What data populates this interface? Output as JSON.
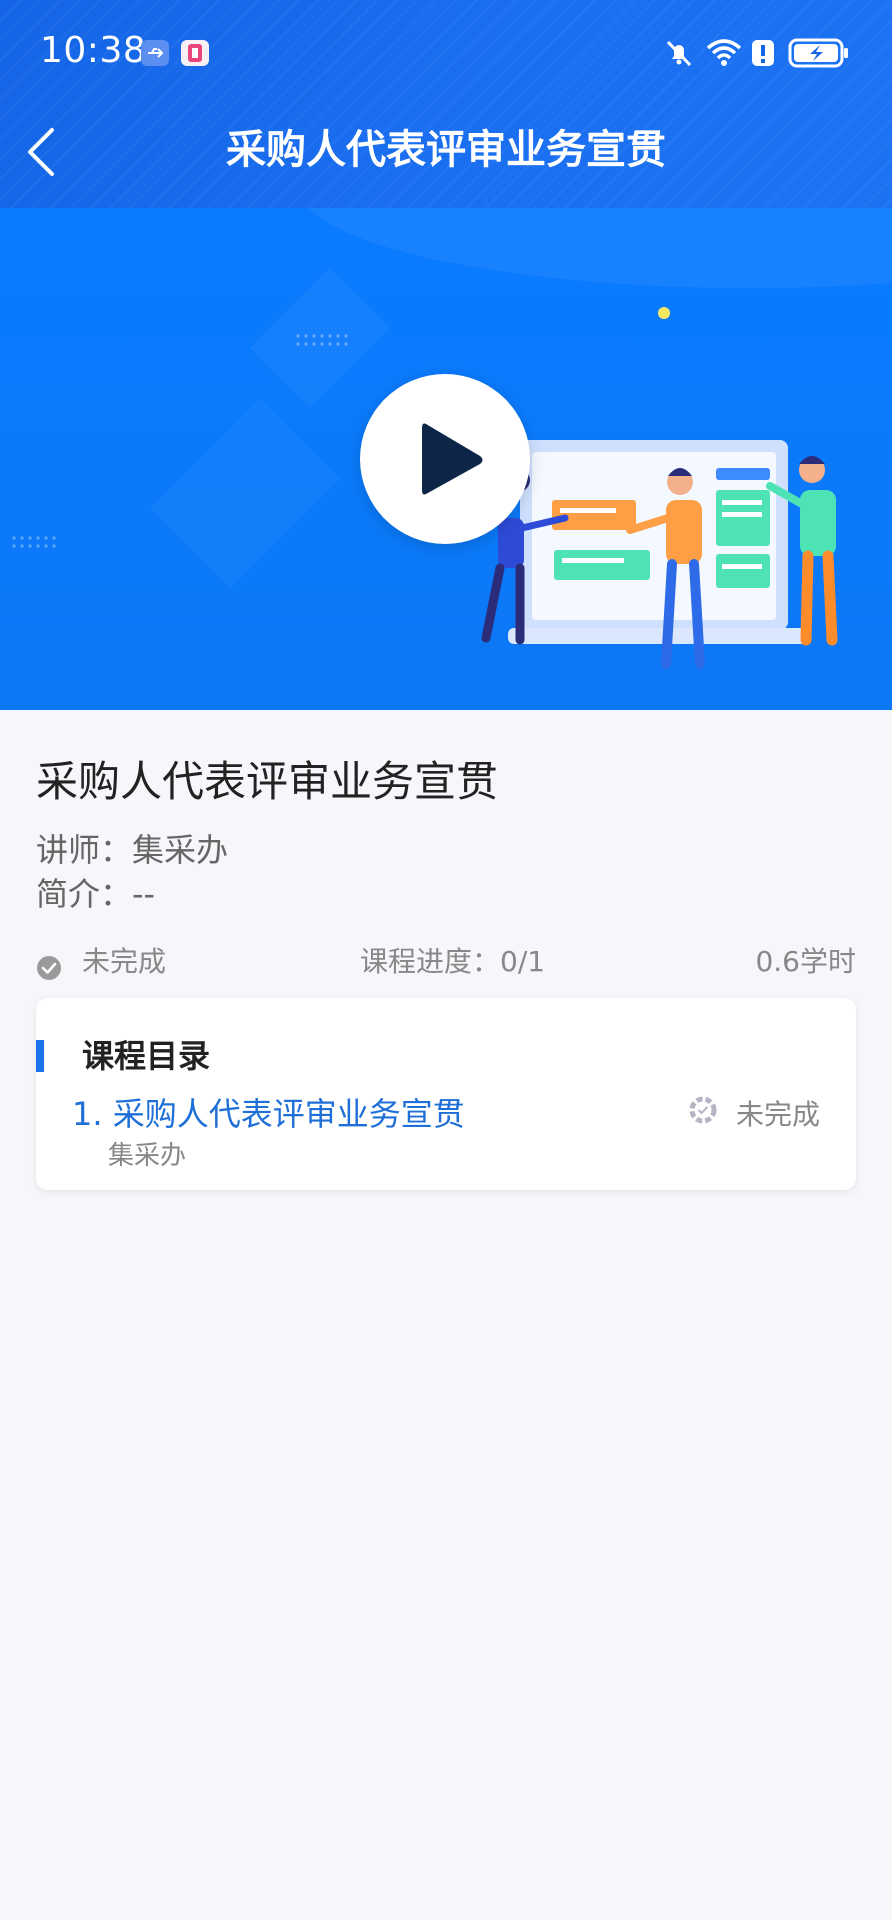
{
  "status_bar": {
    "time": "10:38",
    "icons": [
      "usb-icon",
      "app-notification-icon",
      "mute-bell-icon",
      "wifi-icon",
      "alert-icon",
      "battery-charging-icon"
    ]
  },
  "nav": {
    "back_icon": "chevron-left-icon",
    "title": "采购人代表评审业务宣贯"
  },
  "banner": {
    "play_icon": "play-icon"
  },
  "course": {
    "title": "采购人代表评审业务宣贯",
    "lecturer": "讲师：集采办",
    "intro": "简介：--",
    "status": "未完成",
    "progress": "课程进度：0/1",
    "hours": "0.6学时"
  },
  "catalog": {
    "title": "课程目录",
    "lessons": [
      {
        "title": "1. 采购人代表评审业务宣贯",
        "lecturer": "集采办",
        "status": "未完成"
      }
    ]
  },
  "colors": {
    "primary": "#1a73e8",
    "header": "#1565e6",
    "banner": "#0a7bff",
    "play_triangle": "#0d2547"
  }
}
